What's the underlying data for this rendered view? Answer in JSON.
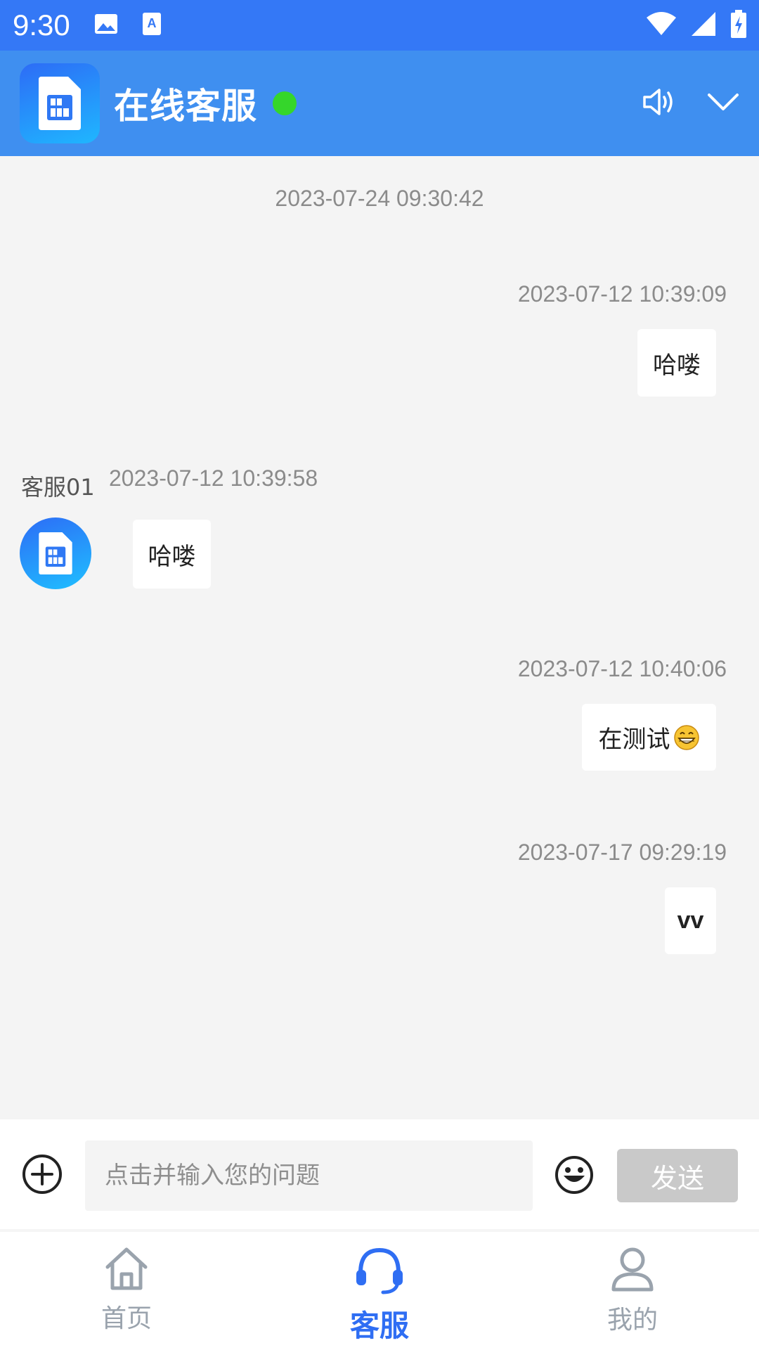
{
  "status_bar": {
    "time": "9:30",
    "icons": [
      "image-icon",
      "a-notification-icon",
      "wifi-icon",
      "signal-icon",
      "battery-icon"
    ]
  },
  "header": {
    "title": "在线客服",
    "online_color": "#35d62b",
    "bg_color": "#3f8ff0"
  },
  "chat": {
    "messages": [
      {
        "type": "system-time",
        "time": "2023-07-24 09:30:42"
      },
      {
        "type": "outgoing",
        "time": "2023-07-12 10:39:09",
        "text": "哈喽"
      },
      {
        "type": "incoming",
        "sender": "客服01",
        "time": "2023-07-12 10:39:58",
        "text": "哈喽"
      },
      {
        "type": "outgoing",
        "time": "2023-07-12 10:40:06",
        "text": "在测试",
        "emoji": "😁"
      },
      {
        "type": "outgoing",
        "time": "2023-07-17 09:29:19",
        "text": "vv"
      }
    ]
  },
  "input_bar": {
    "placeholder": "点击并输入您的问题",
    "value": "",
    "send_label": "发送"
  },
  "tab_bar": {
    "tabs": [
      {
        "label": "首页",
        "icon": "home-icon",
        "active": false
      },
      {
        "label": "客服",
        "icon": "headset-icon",
        "active": true
      },
      {
        "label": "我的",
        "icon": "user-icon",
        "active": false
      }
    ],
    "active_color": "#2f6ef3",
    "inactive_color": "#9aa3ad"
  }
}
